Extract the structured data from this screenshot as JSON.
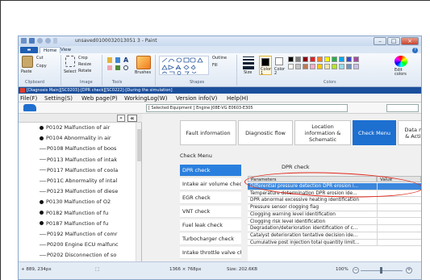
{
  "paint": {
    "title": "unsaved0100032013051 3 - Paint",
    "tabs": [
      "Home",
      "View"
    ],
    "menu_button": "▬",
    "clipboard": {
      "cut": "Cut",
      "copy": "Copy",
      "paste": "Paste",
      "label": "Clipboard"
    },
    "image": {
      "crop": "Crop",
      "resize": "Resize",
      "rotate": "Rotate",
      "select": "Select",
      "label": "Image"
    },
    "tools": {
      "label": "Tools"
    },
    "brushes": "Brushes",
    "shapes": {
      "outline": "Outline",
      "fill": "Fill",
      "label": "Shapes"
    },
    "size": "Size",
    "color1": "Color\n1",
    "color2": "Color\n2",
    "colors_label": "Colors",
    "edit_colors": "Edit\ncolors",
    "palette": [
      "#000000",
      "#7f7f7f",
      "#880015",
      "#ed1c24",
      "#ff7f27",
      "#fff200",
      "#22b14c",
      "#00a2e8",
      "#3f48cc",
      "#a349a4",
      "#ffffff",
      "#c3c3c3",
      "#b97a57",
      "#ffaec9",
      "#ffc90e",
      "#efe4b0",
      "#b5e61d",
      "#99d9ea",
      "#7092be",
      "#c8bfe7"
    ],
    "status": {
      "cursor": "+ 889, 234px",
      "dimensions": "1366 × 768px",
      "filesize": "Size: 202.6KB",
      "zoom": "100%"
    }
  },
  "app": {
    "title": "[Diagnosis Main][SC0203]-[DPR check][SC0222]-[During the simulation]",
    "menu": [
      "File(F)",
      "Setting(S)",
      "Web page(P)",
      "WorkingLog(W)",
      "Version info(V)",
      "Help(H)"
    ],
    "selected_equipment": "[ Selected Equipment ]  Engine  J08E-VG E0603-E305",
    "tree_collapse": "«",
    "tree_collapse_small": "»",
    "tree": [
      {
        "kind": "bullet",
        "text": "P0102 Malfunction of air"
      },
      {
        "kind": "bullet",
        "text": "P0104 Abnormality in air"
      },
      {
        "kind": "dash",
        "text": "P0108 Malfunction of boos"
      },
      {
        "kind": "dash",
        "text": "P0113 Malfunction of intak"
      },
      {
        "kind": "dash",
        "text": "P0117 Malfunction of coola"
      },
      {
        "kind": "dash",
        "text": "P011C Abnormality of intal"
      },
      {
        "kind": "dash",
        "text": "P0123 Malfunction of diese"
      },
      {
        "kind": "bullet",
        "text": "P0130 Malfunction of O2"
      },
      {
        "kind": "bullet",
        "text": "P0182 Malfunction of fu"
      },
      {
        "kind": "bullet",
        "text": "P0187 Malfunction of fu"
      },
      {
        "kind": "dash",
        "text": "P0192 Malfunction of comr"
      },
      {
        "kind": "dash",
        "text": "P0200 Engine ECU malfunc"
      },
      {
        "kind": "dash",
        "text": "P0202 Disconnection of so"
      }
    ],
    "tabs": [
      "Fault information",
      "Diagnostic flow",
      "Location information & Schematic",
      "Check Menu",
      "Data monitor & Active test"
    ],
    "check_menu_title": "Check Menu",
    "check_items": [
      "DPR check",
      "Intake air volume check",
      "EGR check",
      "VNT check",
      "Fuel leak check",
      "Turbocharger check",
      "Intake throttle valve check"
    ],
    "dpr_title": "DPR check",
    "table_headers": [
      "Parameters",
      "Value"
    ],
    "table_rows": [
      "Differential pressure detection DPR erosion i...",
      "Temperature determination DPR erosion ide...",
      "DPR abnormal excessive heating identification",
      "Pressure sensor clogging flag",
      "Clogging warning level identification",
      "Clogging risk level identification",
      "Degradation/deterioration identification of c...",
      "Catalyst deterioration tentative decision ide...",
      "Cumulative post injection total quantity limit..."
    ]
  }
}
